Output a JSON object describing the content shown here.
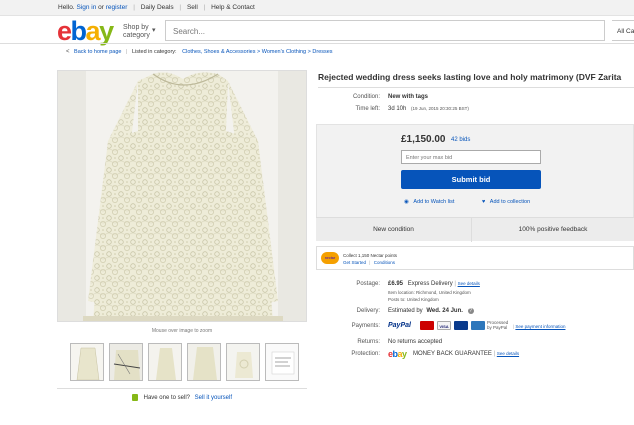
{
  "topbar": {
    "greeting": "Hello.",
    "sign_in": "Sign in",
    "or": "or",
    "register": "register",
    "daily_deals": "Daily Deals",
    "sell": "Sell",
    "help": "Help & Contact"
  },
  "header": {
    "shop_by_category": "Shop by category",
    "search_placeholder": "Search...",
    "all_categories": "All Ca"
  },
  "breadcrumb": {
    "back": "Back to home page",
    "listed_in": "Listed in category:",
    "path": "Clothes, Shoes & Accessories > Women's Clothing > Dresses"
  },
  "gallery": {
    "hint": "Mouse over image to zoom",
    "thumbnail_count": 6,
    "sell_prompt": "Have one to sell?",
    "sell_link": "Sell it yourself"
  },
  "listing": {
    "title": "Rejected wedding dress seeks lasting love and holy matrimony (DVF Zarita",
    "condition_label": "Condition:",
    "condition_value": "New with tags",
    "time_left_label": "Time left:",
    "time_left_value": "3d 10h",
    "time_left_detail": "(19 Jun, 2015   20:30:25 BST)",
    "price": "£1,150.00",
    "bids": "42 bids",
    "max_bid_placeholder": "Enter your max bid",
    "submit_bid": "Submit bid",
    "add_to_watch": "Add to Watch list",
    "add_to_collection": "Add to collection",
    "cond_strip_left": "New condition",
    "cond_strip_right": "100% positive feedback"
  },
  "nectar": {
    "logo": "nectar",
    "line1": "Collect 1,150 Nectar points",
    "line2a": "Get Started",
    "line2b": "Conditions"
  },
  "shipping": {
    "postage_label": "Postage:",
    "postage_value": "£6.95",
    "postage_method": "Express Delivery",
    "see_details": "See details",
    "item_location": "Item location:  Richmond, United Kingdom",
    "posts_to": "Posts to:  United Kingdom",
    "delivery_label": "Delivery:",
    "delivery_prefix": "Estimated by",
    "delivery_date": "Wed. 24 Jun.",
    "payments_label": "Payments:",
    "paypal": "PayPal",
    "processed_by": "Processed by PayPal",
    "see_payment": "See payment information",
    "returns_label": "Returns:",
    "returns_value": "No returns accepted",
    "protection_label": "Protection:",
    "protection_value": "MONEY BACK GUARANTEE",
    "see_details2": "See details"
  },
  "colors": {
    "link": "#0654ba",
    "button": "#0654ba",
    "ebay_red": "#e53238",
    "ebay_blue": "#0064d2",
    "ebay_yellow": "#f5af02",
    "ebay_green": "#86b817"
  }
}
